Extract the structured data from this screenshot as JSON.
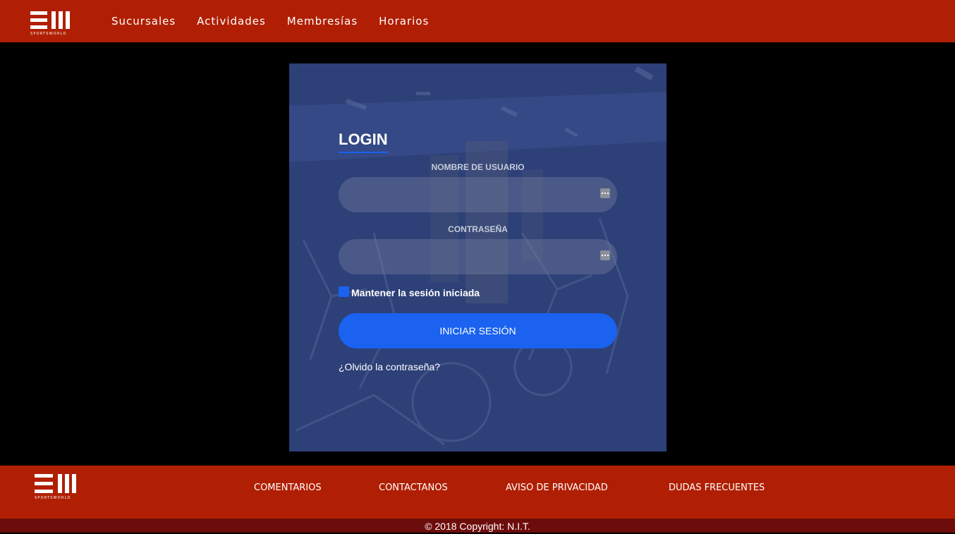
{
  "header": {
    "logo_text": "SPORTSWORLD",
    "nav": [
      "Sucursales",
      "Actividades",
      "Membresías",
      "Horarios"
    ]
  },
  "login": {
    "title": "LOGIN",
    "username_label": "NOMBRE DE USUARIO",
    "username_value": "",
    "password_label": "CONTRASEÑA",
    "password_value": "",
    "field_icon": "ellipsis-key-icon",
    "remember_label": "Mantener la sesión iniciada",
    "remember_checked": true,
    "submit_label": "INICIAR SESIÓN",
    "forgot_label": "¿Olvido la contraseña?"
  },
  "footer": {
    "logo_text": "SPORTSWORLD",
    "links": [
      "COMENTARIOS",
      "CONTACTANOS",
      "AVISO DE PRIVACIDAD",
      "DUDAS FRECUENTES"
    ],
    "copyright": "© 2018 Copyright: N.I.T."
  },
  "colors": {
    "brand_red": "#b01f03",
    "dark_red": "#6d0d0b",
    "accent_blue": "#1a62ef",
    "card_blue": "#2f4378"
  }
}
